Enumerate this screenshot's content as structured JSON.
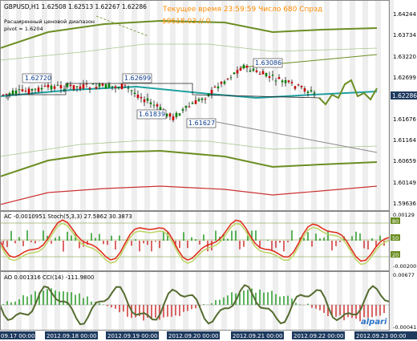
{
  "window": {
    "symbol_line": "GBPUSD,H1  1.62508 1.62513 1.62267 1.62286",
    "indicator_name": "Расширенный ценовой диапазон",
    "indicator_pivot": "pivot = 1.6204",
    "server_time": "Текущее время 23:59:59 Число 680 Спрэд",
    "balance_text": "$9618.03    // 0"
  },
  "main_chart": {
    "price_axis": [
      "1.64244",
      "1.63734",
      "1.63220",
      "1.62699",
      "1.62286",
      "1.61676",
      "1.61164",
      "1.60659",
      "1.60149",
      "1.59636"
    ],
    "current_price": "1.62286",
    "price_labels": [
      "1.62720",
      "1.62699",
      "1.61839",
      "1.61627",
      "1.63086"
    ],
    "colors": {
      "up_candle": "#008000",
      "down_candle": "#cc0000",
      "band_green": "#6b8e23",
      "ma_teal": "#20a0a0",
      "band_red": "#cc3333",
      "price_tag": "#1e3a5f"
    }
  },
  "ac_stoch_panel": {
    "title": "AC -0.0010951  Stoch(5,3,3) 27.5862 30.3873",
    "right_axis": [
      "0.00129",
      "80",
      "50",
      "20",
      "-0.00200"
    ]
  },
  "ao_cci_panel": {
    "title": "AO 0.001316  CCI(14) -111.9800",
    "right_axis": [
      "0.00677",
      "-0.00041"
    ]
  },
  "time_axis": [
    "09.17 00:00",
    "2012.09.18 00:00",
    "2012.09.19 00:00",
    "2012.09.20 00:00",
    "2012.09.21 00:00",
    "2012.09.22 00:00",
    "2012.09.23 00:00"
  ],
  "logo": "alpari"
}
